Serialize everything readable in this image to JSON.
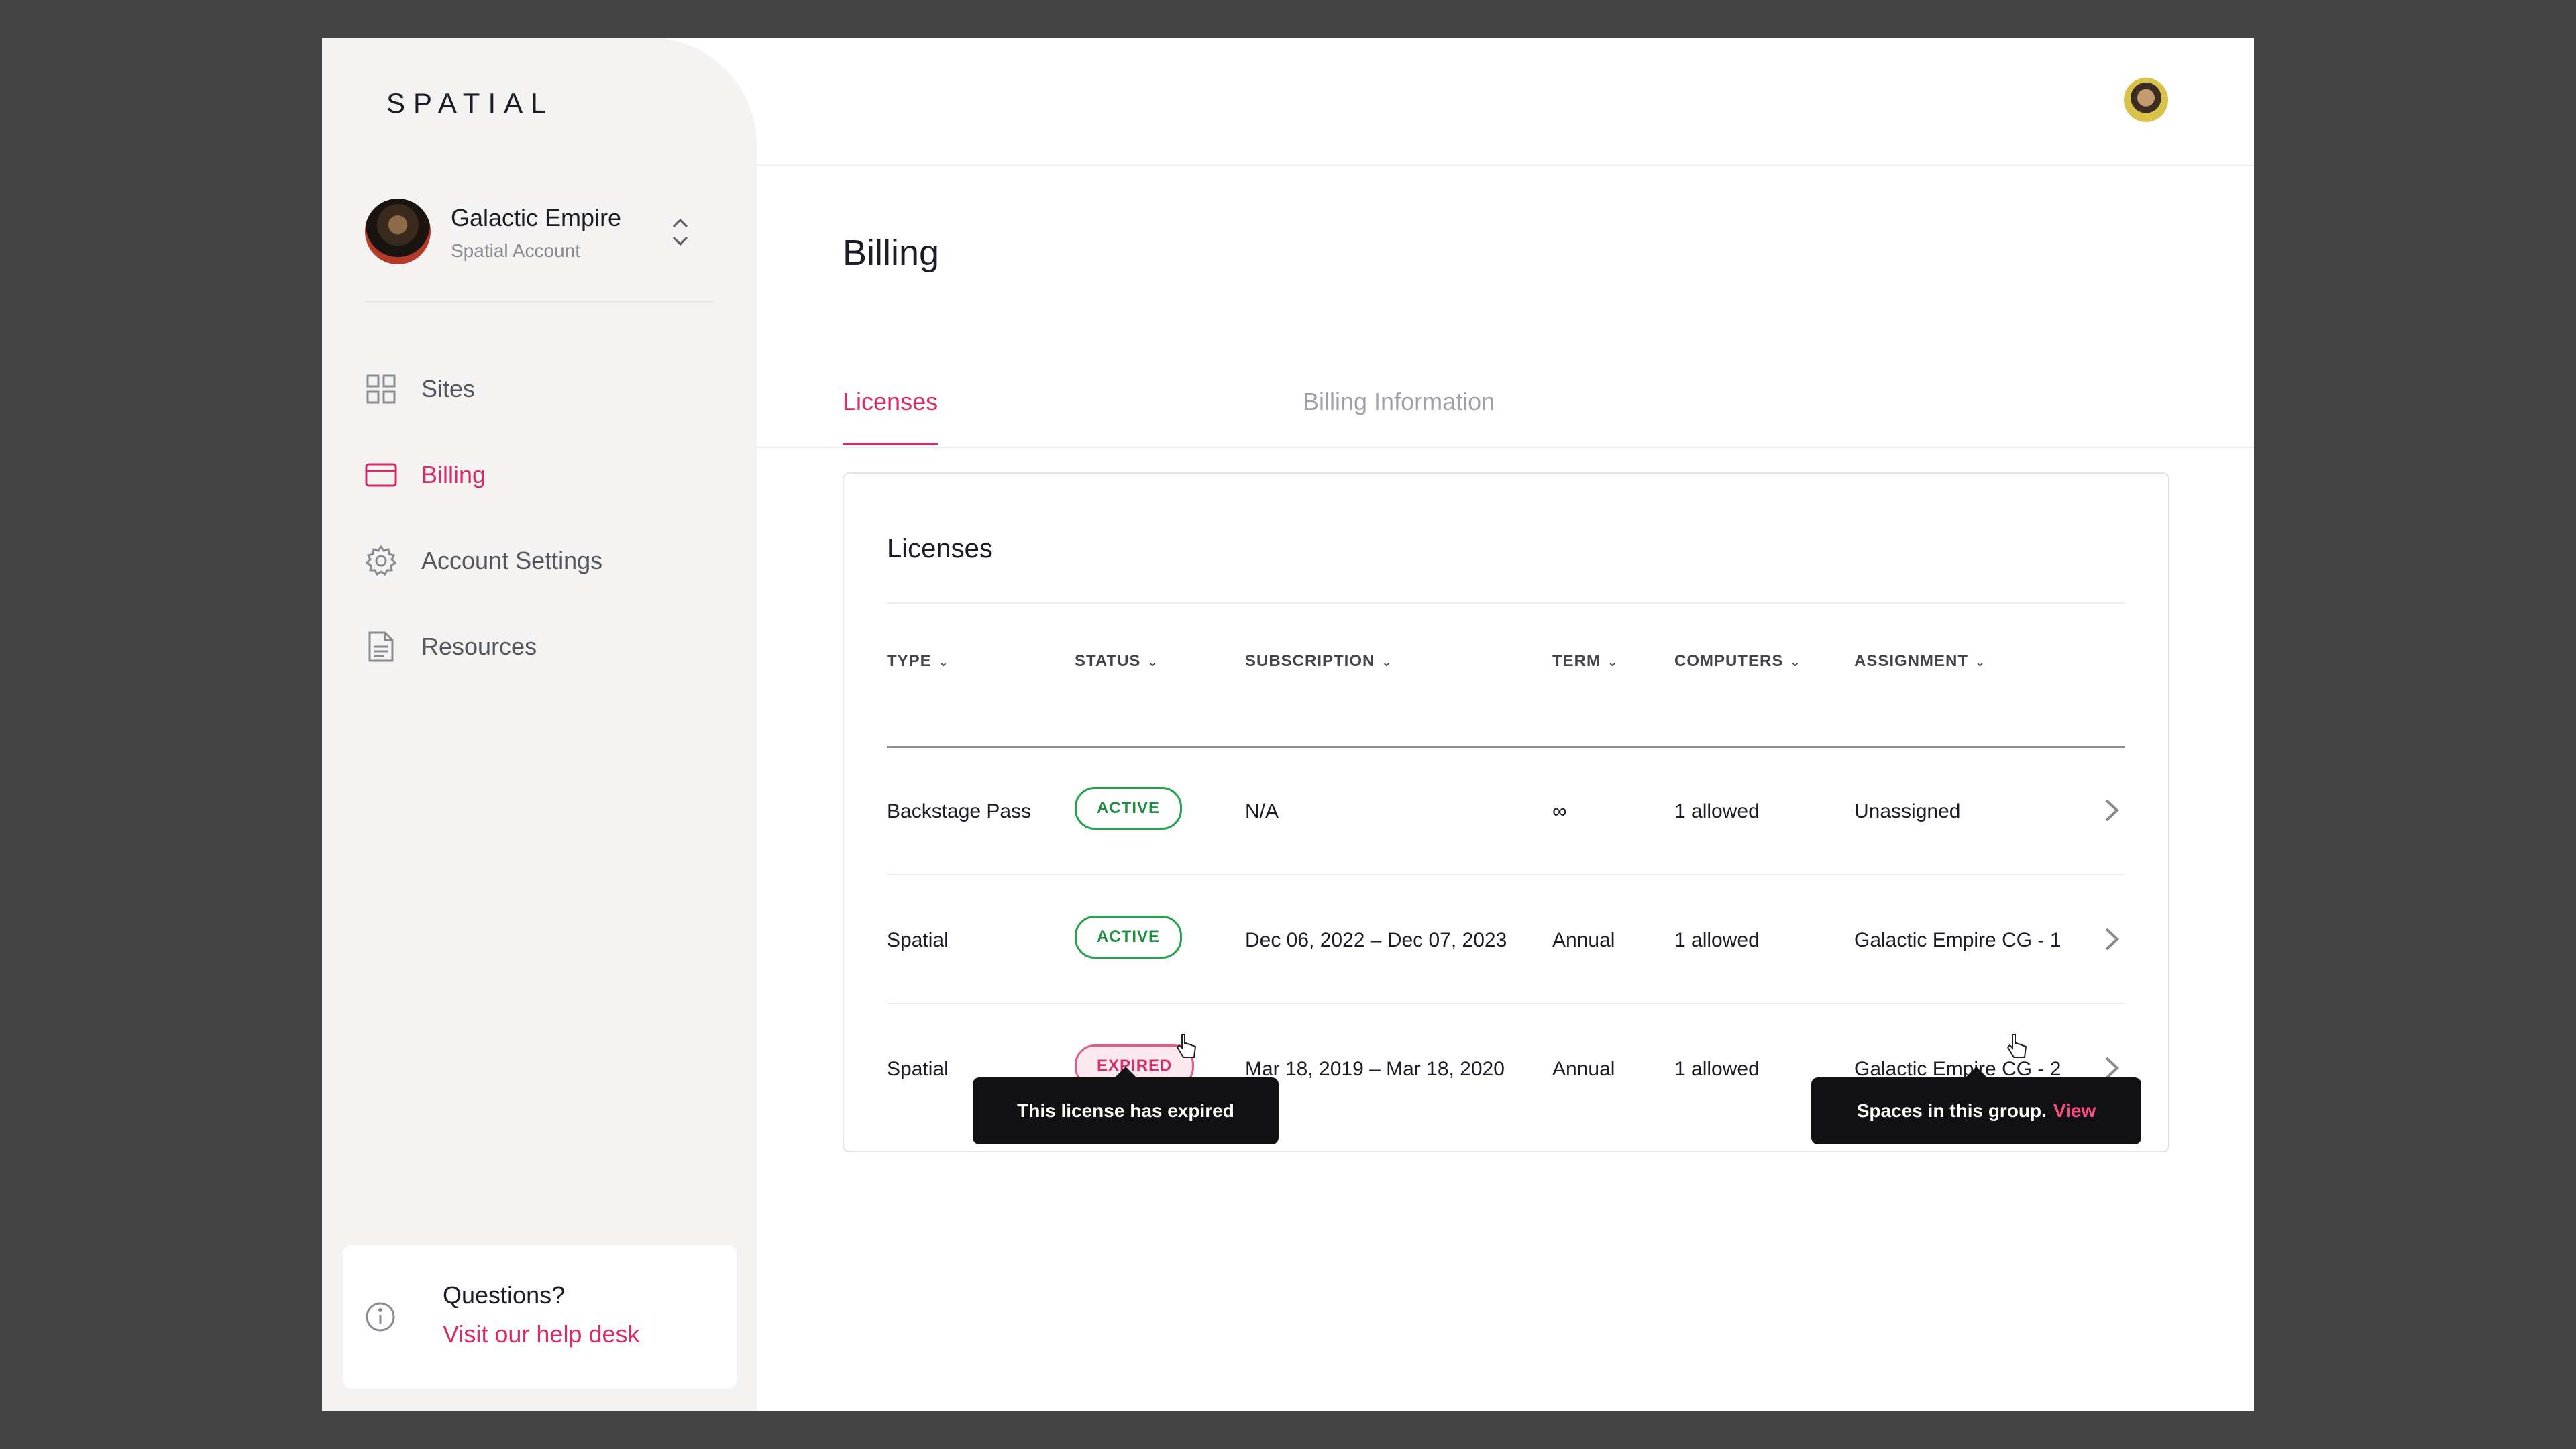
{
  "brand": {
    "logo": "SPATIAL",
    "accent": "#d72d6a"
  },
  "account": {
    "name": "Galactic Empire",
    "subtitle": "Spatial Account"
  },
  "sidebar": {
    "items": [
      {
        "label": "Sites",
        "icon": "grid-icon",
        "active": false
      },
      {
        "label": "Billing",
        "icon": "credit-card-icon",
        "active": true
      },
      {
        "label": "Account Settings",
        "icon": "gear-icon",
        "active": false
      },
      {
        "label": "Resources",
        "icon": "document-icon",
        "active": false
      }
    ],
    "help": {
      "question": "Questions?",
      "link": "Visit our help desk"
    }
  },
  "page": {
    "title": "Billing",
    "tabs": [
      {
        "label": "Licenses",
        "active": true
      },
      {
        "label": "Billing Information",
        "active": false
      }
    ]
  },
  "licenses": {
    "title": "Licenses",
    "columns": [
      "TYPE",
      "STATUS",
      "SUBSCRIPTION",
      "TERM",
      "COMPUTERS",
      "ASSIGNMENT"
    ],
    "rows": [
      {
        "type": "Backstage Pass",
        "status": "ACTIVE",
        "subscription": "N/A",
        "term": "∞",
        "computers": "1 allowed",
        "assignment": "Unassigned"
      },
      {
        "type": "Spatial",
        "status": "ACTIVE",
        "subscription": "Dec 06, 2022 – Dec 07, 2023",
        "term": "Annual",
        "computers": "1 allowed",
        "assignment": "Galactic Empire CG - 1"
      },
      {
        "type": "Spatial",
        "status": "EXPIRED",
        "subscription": "Mar 18, 2019 – Mar 18, 2020",
        "term": "Annual",
        "computers": "1 allowed",
        "assignment": "Galactic Empire CG - 2"
      }
    ]
  },
  "tooltips": {
    "expired": "This license has expired",
    "assignment": {
      "text": "Spaces in this group.",
      "link": "View"
    }
  }
}
